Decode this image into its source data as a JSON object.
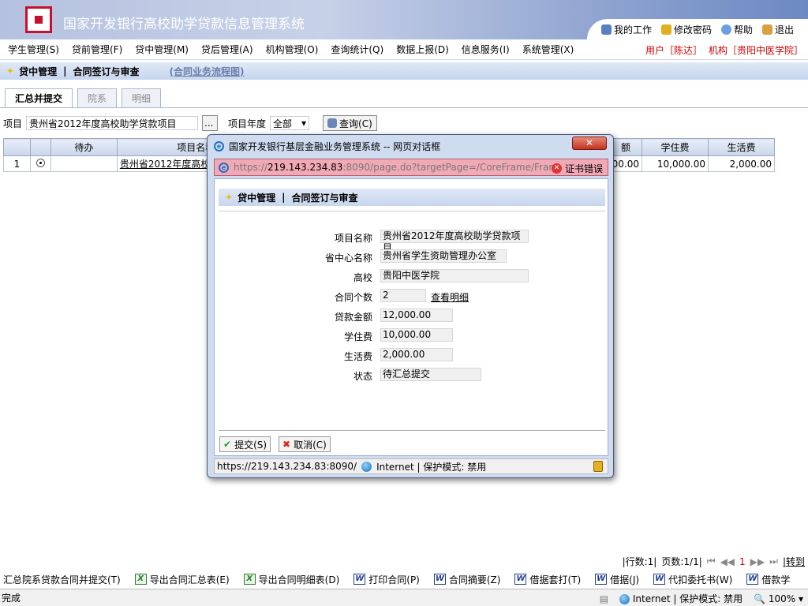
{
  "app": {
    "title": "国家开发银行高校助学贷款信息管理系统",
    "links": {
      "my_work": "我的工作",
      "change_pwd": "修改密码",
      "help": "帮助",
      "logout": "退出"
    }
  },
  "menu": [
    "学生管理(S)",
    "贷前管理(F)",
    "贷中管理(M)",
    "贷后管理(A)",
    "机构管理(O)",
    "查询统计(Q)",
    "数据上报(D)",
    "信息服务(I)",
    "系统管理(X)"
  ],
  "user": {
    "user_label": "用户［陈达］",
    "org_label": "机构［贵阳中医学院］"
  },
  "crumb": {
    "section": "贷中管理",
    "page": "合同签订与审查",
    "flow": "(合同业务流程图)"
  },
  "tabs": [
    "汇总并提交",
    "院系",
    "明细"
  ],
  "filter": {
    "project_label": "项目",
    "project_value": "贵州省2012年度高校助学贷款项目",
    "browse": "...",
    "year_label": "项目年度",
    "year_value": "全部",
    "query_btn": "查询(C)"
  },
  "grid": {
    "headers": [
      "",
      "",
      "待办",
      "项目名称",
      "额",
      "学住费",
      "生活费"
    ],
    "row": {
      "no": "1",
      "project": "贵州省2012年度高校助",
      "amount": "00.00",
      "tuition": "10,000.00",
      "living": "2,000.00"
    }
  },
  "pager": {
    "rows": "|行数:1|",
    "pages": "页数:1/1|",
    "current": "1",
    "goto": "|转到"
  },
  "toolbar": [
    "汇总院系贷款合同并提交(T)",
    "导出合同汇总表(E)",
    "导出合同明细表(D)",
    "打印合同(P)",
    "合同摘要(Z)",
    "借据套打(T)",
    "借据(J)",
    "代扣委托书(W)",
    "借款学"
  ],
  "status": {
    "left": "完成",
    "zone": "Internet | 保护模式: 禁用",
    "zoom": "100%"
  },
  "dialog": {
    "title": "国家开发银行基层金融业务管理系统 -- 网页对话框",
    "url_host": "219.143.234.83",
    "url_rest": ":8090/page.do?targetPage=/CoreFrame/Frar",
    "url_prefix": "https://",
    "cert_error": "证书错误",
    "crumb_section": "贷中管理",
    "crumb_page": "合同签订与审查",
    "fields": [
      {
        "label": "项目名称",
        "value": "贵州省2012年度高校助学贷款项目"
      },
      {
        "label": "省中心名称",
        "value": "贵州省学生资助管理办公室"
      },
      {
        "label": "高校",
        "value": "贵阳中医学院"
      },
      {
        "label": "合同个数",
        "value": "2"
      },
      {
        "label": "贷款金额",
        "value": "12,000.00"
      },
      {
        "label": "学住费",
        "value": "10,000.00"
      },
      {
        "label": "生活费",
        "value": "2,000.00"
      },
      {
        "label": "状态",
        "value": "待汇总提交"
      }
    ],
    "detail_link": "查看明细",
    "submit": "提交(S)",
    "cancel": "取消(C)",
    "status_url": "https://219.143.234.83:8090/",
    "status_zone": "Internet | 保护模式: 禁用"
  }
}
